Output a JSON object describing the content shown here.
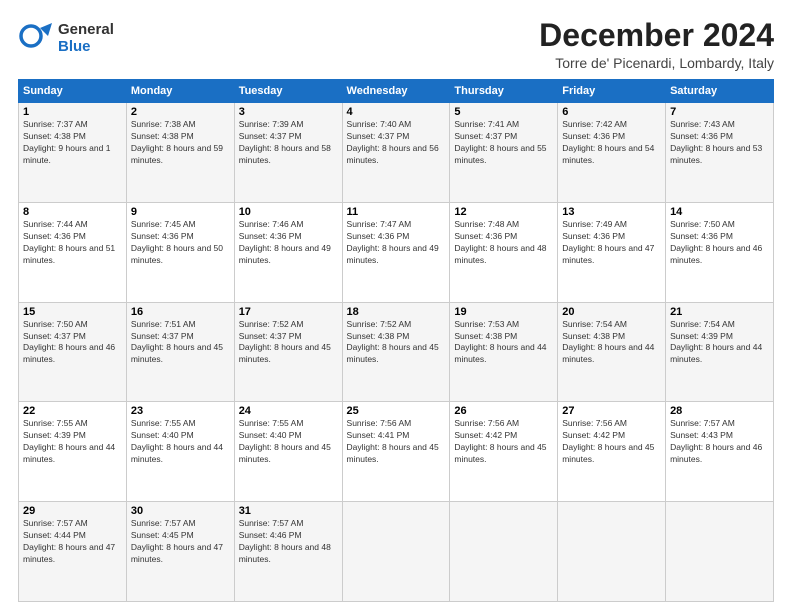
{
  "header": {
    "logo_line1": "General",
    "logo_line2": "Blue",
    "month_title": "December 2024",
    "location": "Torre de' Picenardi, Lombardy, Italy"
  },
  "weekdays": [
    "Sunday",
    "Monday",
    "Tuesday",
    "Wednesday",
    "Thursday",
    "Friday",
    "Saturday"
  ],
  "weeks": [
    [
      {
        "day": "1",
        "sunrise": "7:37 AM",
        "sunset": "4:38 PM",
        "daylight": "9 hours and 1 minute."
      },
      {
        "day": "2",
        "sunrise": "7:38 AM",
        "sunset": "4:38 PM",
        "daylight": "8 hours and 59 minutes."
      },
      {
        "day": "3",
        "sunrise": "7:39 AM",
        "sunset": "4:37 PM",
        "daylight": "8 hours and 58 minutes."
      },
      {
        "day": "4",
        "sunrise": "7:40 AM",
        "sunset": "4:37 PM",
        "daylight": "8 hours and 56 minutes."
      },
      {
        "day": "5",
        "sunrise": "7:41 AM",
        "sunset": "4:37 PM",
        "daylight": "8 hours and 55 minutes."
      },
      {
        "day": "6",
        "sunrise": "7:42 AM",
        "sunset": "4:36 PM",
        "daylight": "8 hours and 54 minutes."
      },
      {
        "day": "7",
        "sunrise": "7:43 AM",
        "sunset": "4:36 PM",
        "daylight": "8 hours and 53 minutes."
      }
    ],
    [
      {
        "day": "8",
        "sunrise": "7:44 AM",
        "sunset": "4:36 PM",
        "daylight": "8 hours and 51 minutes."
      },
      {
        "day": "9",
        "sunrise": "7:45 AM",
        "sunset": "4:36 PM",
        "daylight": "8 hours and 50 minutes."
      },
      {
        "day": "10",
        "sunrise": "7:46 AM",
        "sunset": "4:36 PM",
        "daylight": "8 hours and 49 minutes."
      },
      {
        "day": "11",
        "sunrise": "7:47 AM",
        "sunset": "4:36 PM",
        "daylight": "8 hours and 49 minutes."
      },
      {
        "day": "12",
        "sunrise": "7:48 AM",
        "sunset": "4:36 PM",
        "daylight": "8 hours and 48 minutes."
      },
      {
        "day": "13",
        "sunrise": "7:49 AM",
        "sunset": "4:36 PM",
        "daylight": "8 hours and 47 minutes."
      },
      {
        "day": "14",
        "sunrise": "7:50 AM",
        "sunset": "4:36 PM",
        "daylight": "8 hours and 46 minutes."
      }
    ],
    [
      {
        "day": "15",
        "sunrise": "7:50 AM",
        "sunset": "4:37 PM",
        "daylight": "8 hours and 46 minutes."
      },
      {
        "day": "16",
        "sunrise": "7:51 AM",
        "sunset": "4:37 PM",
        "daylight": "8 hours and 45 minutes."
      },
      {
        "day": "17",
        "sunrise": "7:52 AM",
        "sunset": "4:37 PM",
        "daylight": "8 hours and 45 minutes."
      },
      {
        "day": "18",
        "sunrise": "7:52 AM",
        "sunset": "4:38 PM",
        "daylight": "8 hours and 45 minutes."
      },
      {
        "day": "19",
        "sunrise": "7:53 AM",
        "sunset": "4:38 PM",
        "daylight": "8 hours and 44 minutes."
      },
      {
        "day": "20",
        "sunrise": "7:54 AM",
        "sunset": "4:38 PM",
        "daylight": "8 hours and 44 minutes."
      },
      {
        "day": "21",
        "sunrise": "7:54 AM",
        "sunset": "4:39 PM",
        "daylight": "8 hours and 44 minutes."
      }
    ],
    [
      {
        "day": "22",
        "sunrise": "7:55 AM",
        "sunset": "4:39 PM",
        "daylight": "8 hours and 44 minutes."
      },
      {
        "day": "23",
        "sunrise": "7:55 AM",
        "sunset": "4:40 PM",
        "daylight": "8 hours and 44 minutes."
      },
      {
        "day": "24",
        "sunrise": "7:55 AM",
        "sunset": "4:40 PM",
        "daylight": "8 hours and 45 minutes."
      },
      {
        "day": "25",
        "sunrise": "7:56 AM",
        "sunset": "4:41 PM",
        "daylight": "8 hours and 45 minutes."
      },
      {
        "day": "26",
        "sunrise": "7:56 AM",
        "sunset": "4:42 PM",
        "daylight": "8 hours and 45 minutes."
      },
      {
        "day": "27",
        "sunrise": "7:56 AM",
        "sunset": "4:42 PM",
        "daylight": "8 hours and 45 minutes."
      },
      {
        "day": "28",
        "sunrise": "7:57 AM",
        "sunset": "4:43 PM",
        "daylight": "8 hours and 46 minutes."
      }
    ],
    [
      {
        "day": "29",
        "sunrise": "7:57 AM",
        "sunset": "4:44 PM",
        "daylight": "8 hours and 47 minutes."
      },
      {
        "day": "30",
        "sunrise": "7:57 AM",
        "sunset": "4:45 PM",
        "daylight": "8 hours and 47 minutes."
      },
      {
        "day": "31",
        "sunrise": "7:57 AM",
        "sunset": "4:46 PM",
        "daylight": "8 hours and 48 minutes."
      },
      null,
      null,
      null,
      null
    ]
  ]
}
